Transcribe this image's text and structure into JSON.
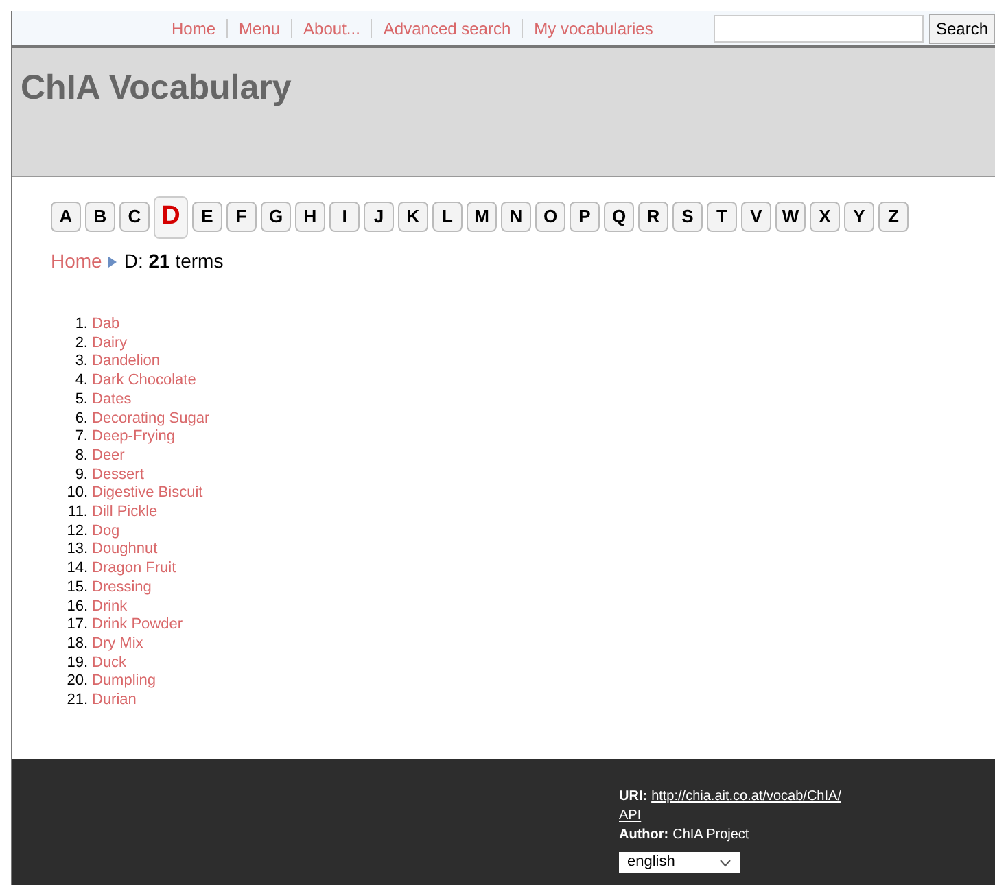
{
  "nav": {
    "links": [
      "Home",
      "Menu",
      "About...",
      "Advanced search",
      "My vocabularies"
    ],
    "search_button": "Search"
  },
  "header": {
    "title": "ChIA Vocabulary"
  },
  "letters": [
    {
      "label": "A",
      "selected": false
    },
    {
      "label": "B",
      "selected": false
    },
    {
      "label": "C",
      "selected": false
    },
    {
      "label": "D",
      "selected": true
    },
    {
      "label": "E",
      "selected": false
    },
    {
      "label": "F",
      "selected": false
    },
    {
      "label": "G",
      "selected": false
    },
    {
      "label": "H",
      "selected": false
    },
    {
      "label": "I",
      "selected": false
    },
    {
      "label": "J",
      "selected": false
    },
    {
      "label": "K",
      "selected": false
    },
    {
      "label": "L",
      "selected": false
    },
    {
      "label": "M",
      "selected": false
    },
    {
      "label": "N",
      "selected": false
    },
    {
      "label": "O",
      "selected": false
    },
    {
      "label": "P",
      "selected": false
    },
    {
      "label": "Q",
      "selected": false
    },
    {
      "label": "R",
      "selected": false
    },
    {
      "label": "S",
      "selected": false
    },
    {
      "label": "T",
      "selected": false
    },
    {
      "label": "V",
      "selected": false
    },
    {
      "label": "W",
      "selected": false
    },
    {
      "label": "X",
      "selected": false
    },
    {
      "label": "Y",
      "selected": false
    },
    {
      "label": "Z",
      "selected": false
    }
  ],
  "breadcrumb": {
    "home": "Home",
    "current": "D: **21** terms"
  },
  "terms": [
    {
      "number": "1.",
      "label": "Dab"
    },
    {
      "number": "2.",
      "label": "Dairy"
    },
    {
      "number": "3.",
      "label": "Dandelion"
    },
    {
      "number": "4.",
      "label": "Dark Chocolate"
    },
    {
      "number": "5.",
      "label": "Dates"
    },
    {
      "number": "6.",
      "label": "Decorating Sugar"
    },
    {
      "number": "7.",
      "label": "Deep-Frying"
    },
    {
      "number": "8.",
      "label": "Deer"
    },
    {
      "number": "9.",
      "label": "Dessert"
    },
    {
      "number": "10.",
      "label": "Digestive Biscuit"
    },
    {
      "number": "11.",
      "label": "Dill Pickle"
    },
    {
      "number": "12.",
      "label": "Dog"
    },
    {
      "number": "13.",
      "label": "Doughnut"
    },
    {
      "number": "14.",
      "label": "Dragon Fruit"
    },
    {
      "number": "15.",
      "label": "Dressing"
    },
    {
      "number": "16.",
      "label": "Drink"
    },
    {
      "number": "17.",
      "label": "Drink Powder"
    },
    {
      "number": "18.",
      "label": "Dry Mix"
    },
    {
      "number": "19.",
      "label": "Duck"
    },
    {
      "number": "20.",
      "label": "Dumpling"
    },
    {
      "number": "21.",
      "label": "Durian"
    }
  ],
  "footer": {
    "uri_label": "URI:",
    "uri": "http://chia.ait.co.at/vocab/ChIA/",
    "api": "API",
    "author_label": "Author:",
    "author": "ChIA Project",
    "language": "english"
  }
}
